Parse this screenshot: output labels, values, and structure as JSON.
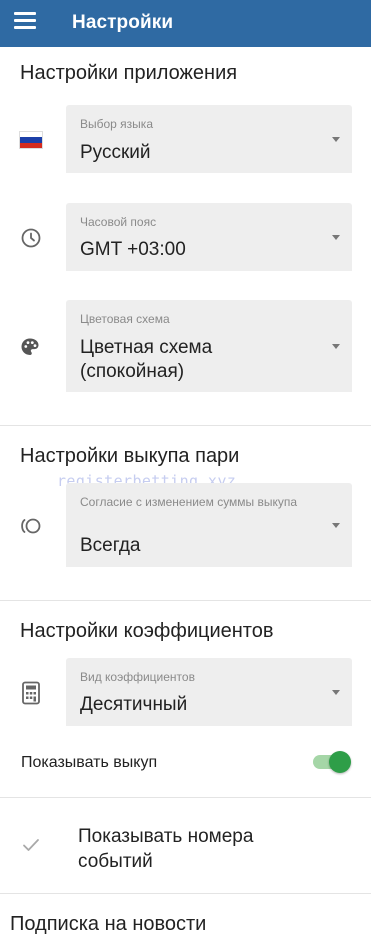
{
  "appbar": {
    "title": "Настройки",
    "menu_icon": "hamburger-menu-icon"
  },
  "app_settings": {
    "title": "Настройки приложения",
    "language": {
      "label": "Выбор языка",
      "value": "Русский",
      "icon": "russia-flag-icon"
    },
    "timezone": {
      "label": "Часовой пояс",
      "value": "GMT +03:00",
      "icon": "clock-icon"
    },
    "color_scheme": {
      "label": "Цветовая схема",
      "value": "Цветная схема (спокойная)",
      "icon": "palette-icon"
    }
  },
  "cashout_settings": {
    "title": "Настройки выкупа пари",
    "agreement": {
      "label": "Согласие с изменением суммы выкупа",
      "value": "Всегда",
      "icon": "cashout-icon"
    }
  },
  "odds_settings": {
    "title": "Настройки коэффициентов",
    "odds_type": {
      "label": "Вид коэффициентов",
      "value": "Десятичный",
      "icon": "calculator-icon"
    },
    "show_cashout": {
      "label": "Показывать выкуп",
      "enabled": true
    }
  },
  "show_event_numbers": {
    "label": "Показывать номера событий",
    "checked": true
  },
  "newsletter": {
    "title": "Подписка на новости"
  },
  "watermark": "registerbetting.xyz",
  "colors": {
    "appbar": "#2f6aa3",
    "toggle_on": "#2e9e48"
  }
}
